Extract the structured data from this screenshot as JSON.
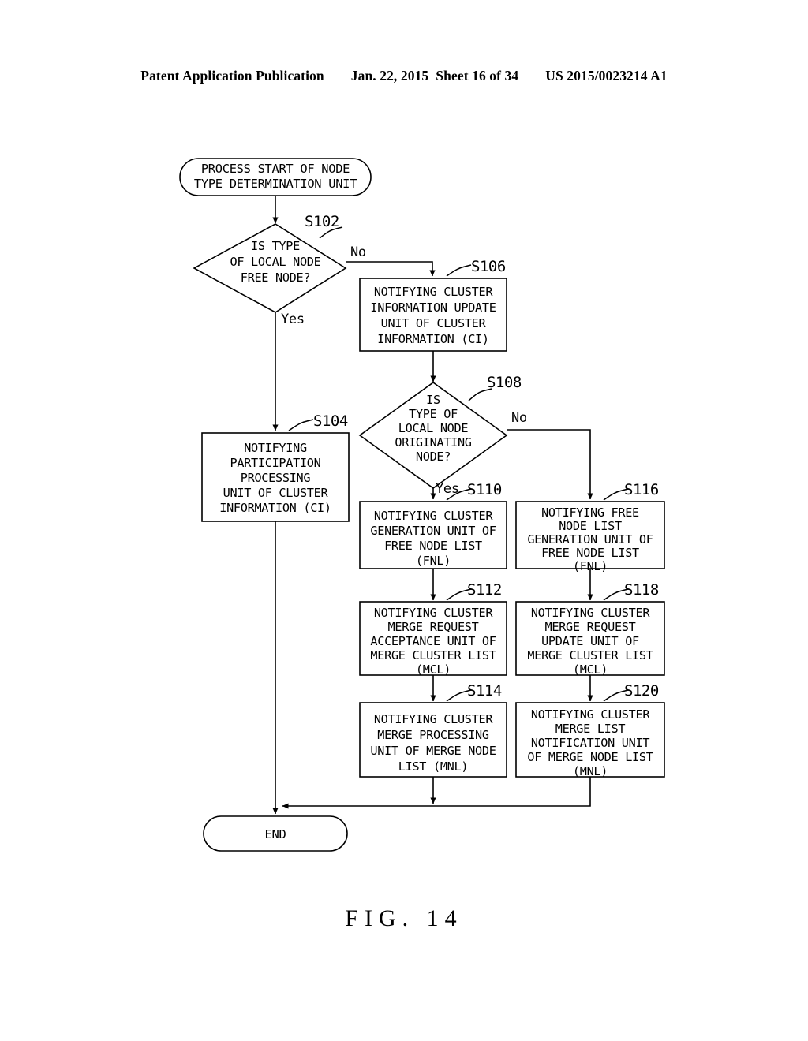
{
  "header": {
    "publication": "Patent Application Publication",
    "date": "Jan. 22, 2015",
    "sheet": "Sheet 16 of 34",
    "number": "US 2015/0023214 A1"
  },
  "figure": {
    "caption": "FIG. 14"
  },
  "colors": {
    "ink": "#000000",
    "paper": "#ffffff"
  },
  "flowchart": {
    "start": {
      "id": "start",
      "type": "terminator",
      "lines": [
        "PROCESS START OF NODE",
        "TYPE DETERMINATION UNIT"
      ]
    },
    "end": {
      "id": "end",
      "type": "terminator",
      "lines": [
        "END"
      ]
    },
    "decisions": [
      {
        "id": "S102",
        "step": "S102",
        "lines": [
          "IS TYPE",
          "OF LOCAL NODE",
          "FREE NODE?"
        ],
        "yes_label": "Yes",
        "no_label": "No"
      },
      {
        "id": "S108",
        "step": "S108",
        "lines": [
          "IS",
          "TYPE OF",
          "LOCAL NODE",
          "ORIGINATING",
          "NODE?"
        ],
        "yes_label": "Yes",
        "no_label": "No"
      }
    ],
    "processes": [
      {
        "id": "S104",
        "step": "S104",
        "lines": [
          "NOTIFYING",
          "PARTICIPATION",
          "PROCESSING",
          "UNIT OF CLUSTER",
          "INFORMATION (CI)"
        ]
      },
      {
        "id": "S106",
        "step": "S106",
        "lines": [
          "NOTIFYING CLUSTER",
          "INFORMATION UPDATE",
          "UNIT OF CLUSTER",
          "INFORMATION (CI)"
        ]
      },
      {
        "id": "S110",
        "step": "S110",
        "lines": [
          "NOTIFYING CLUSTER",
          "GENERATION UNIT OF",
          "FREE NODE LIST",
          "(FNL)"
        ]
      },
      {
        "id": "S112",
        "step": "S112",
        "lines": [
          "NOTIFYING CLUSTER",
          "MERGE REQUEST",
          "ACCEPTANCE UNIT OF",
          "MERGE CLUSTER LIST",
          "(MCL)"
        ]
      },
      {
        "id": "S114",
        "step": "S114",
        "lines": [
          "NOTIFYING CLUSTER",
          "MERGE PROCESSING",
          "UNIT OF MERGE NODE",
          "LIST (MNL)"
        ]
      },
      {
        "id": "S116",
        "step": "S116",
        "lines": [
          "NOTIFYING FREE",
          "NODE LIST",
          "GENERATION UNIT OF",
          "FREE NODE LIST",
          "(FNL)"
        ]
      },
      {
        "id": "S118",
        "step": "S118",
        "lines": [
          "NOTIFYING CLUSTER",
          "MERGE REQUEST",
          "UPDATE UNIT OF",
          "MERGE CLUSTER LIST",
          "(MCL)"
        ]
      },
      {
        "id": "S120",
        "step": "S120",
        "lines": [
          "NOTIFYING CLUSTER",
          "MERGE LIST",
          "NOTIFICATION UNIT",
          "OF MERGE NODE LIST",
          "(MNL)"
        ]
      }
    ]
  }
}
